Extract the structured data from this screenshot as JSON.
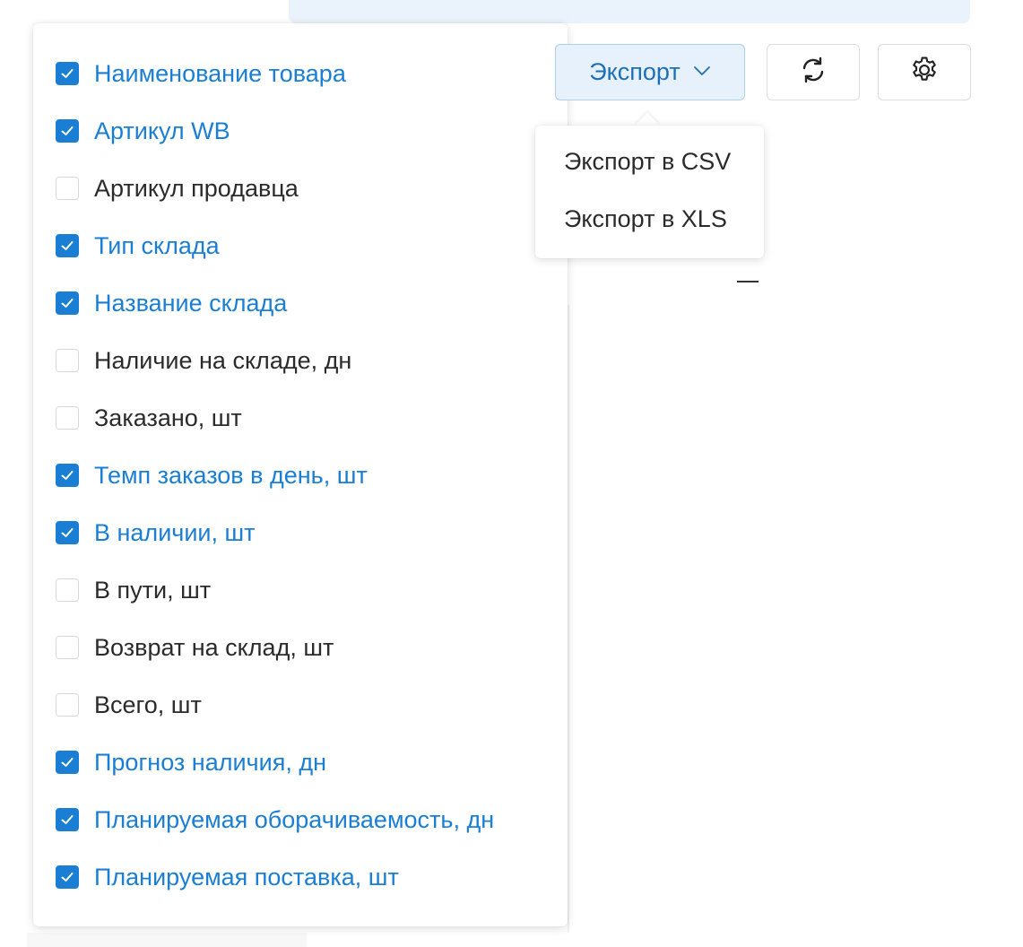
{
  "toolbar": {
    "export_label": "Экспорт",
    "accent_color": "#1a7fd4"
  },
  "export_menu": {
    "items": [
      {
        "label": "Экспорт в CSV"
      },
      {
        "label": "Экспорт в XLS"
      }
    ]
  },
  "columns": [
    {
      "label": "Наименование товара",
      "checked": true
    },
    {
      "label": "Артикул WB",
      "checked": true
    },
    {
      "label": "Артикул продавца",
      "checked": false
    },
    {
      "label": "Тип склада",
      "checked": true
    },
    {
      "label": "Название склада",
      "checked": true
    },
    {
      "label": "Наличие на складе, дн",
      "checked": false
    },
    {
      "label": "Заказано, шт",
      "checked": false
    },
    {
      "label": "Темп заказов в день, шт",
      "checked": true
    },
    {
      "label": "В наличии, шт",
      "checked": true
    },
    {
      "label": "В пути, шт",
      "checked": false
    },
    {
      "label": "Возврат на склад, шт",
      "checked": false
    },
    {
      "label": "Всего, шт",
      "checked": false
    },
    {
      "label": "Прогноз наличия, дн",
      "checked": true
    },
    {
      "label": "Планируемая оборачиваемость, дн",
      "checked": true
    },
    {
      "label": "Планируемая поставка, шт",
      "checked": true
    }
  ],
  "background": {
    "dash_text": "—"
  },
  "icons": {
    "refresh": "refresh-icon",
    "settings": "gear-icon",
    "checkmark": "checkmark-icon",
    "chevron": "chevron-down-icon"
  }
}
